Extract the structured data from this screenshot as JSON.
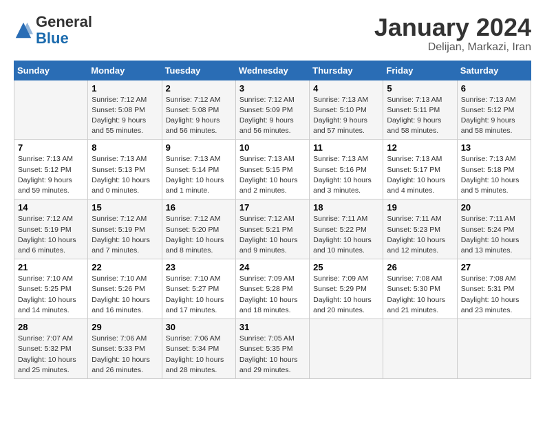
{
  "logo": {
    "general": "General",
    "blue": "Blue"
  },
  "title": {
    "month_year": "January 2024",
    "location": "Delijan, Markazi, Iran"
  },
  "headers": [
    "Sunday",
    "Monday",
    "Tuesday",
    "Wednesday",
    "Thursday",
    "Friday",
    "Saturday"
  ],
  "weeks": [
    [
      null,
      {
        "day": 1,
        "sunrise": "7:12 AM",
        "sunset": "5:08 PM",
        "daylight": "9 hours and 55 minutes."
      },
      {
        "day": 2,
        "sunrise": "7:12 AM",
        "sunset": "5:08 PM",
        "daylight": "9 hours and 56 minutes."
      },
      {
        "day": 3,
        "sunrise": "7:12 AM",
        "sunset": "5:09 PM",
        "daylight": "9 hours and 56 minutes."
      },
      {
        "day": 4,
        "sunrise": "7:13 AM",
        "sunset": "5:10 PM",
        "daylight": "9 hours and 57 minutes."
      },
      {
        "day": 5,
        "sunrise": "7:13 AM",
        "sunset": "5:11 PM",
        "daylight": "9 hours and 58 minutes."
      },
      {
        "day": 6,
        "sunrise": "7:13 AM",
        "sunset": "5:12 PM",
        "daylight": "9 hours and 58 minutes."
      }
    ],
    [
      {
        "day": 7,
        "sunrise": "7:13 AM",
        "sunset": "5:12 PM",
        "daylight": "9 hours and 59 minutes."
      },
      {
        "day": 8,
        "sunrise": "7:13 AM",
        "sunset": "5:13 PM",
        "daylight": "10 hours and 0 minutes."
      },
      {
        "day": 9,
        "sunrise": "7:13 AM",
        "sunset": "5:14 PM",
        "daylight": "10 hours and 1 minute."
      },
      {
        "day": 10,
        "sunrise": "7:13 AM",
        "sunset": "5:15 PM",
        "daylight": "10 hours and 2 minutes."
      },
      {
        "day": 11,
        "sunrise": "7:13 AM",
        "sunset": "5:16 PM",
        "daylight": "10 hours and 3 minutes."
      },
      {
        "day": 12,
        "sunrise": "7:13 AM",
        "sunset": "5:17 PM",
        "daylight": "10 hours and 4 minutes."
      },
      {
        "day": 13,
        "sunrise": "7:13 AM",
        "sunset": "5:18 PM",
        "daylight": "10 hours and 5 minutes."
      }
    ],
    [
      {
        "day": 14,
        "sunrise": "7:12 AM",
        "sunset": "5:19 PM",
        "daylight": "10 hours and 6 minutes."
      },
      {
        "day": 15,
        "sunrise": "7:12 AM",
        "sunset": "5:19 PM",
        "daylight": "10 hours and 7 minutes."
      },
      {
        "day": 16,
        "sunrise": "7:12 AM",
        "sunset": "5:20 PM",
        "daylight": "10 hours and 8 minutes."
      },
      {
        "day": 17,
        "sunrise": "7:12 AM",
        "sunset": "5:21 PM",
        "daylight": "10 hours and 9 minutes."
      },
      {
        "day": 18,
        "sunrise": "7:11 AM",
        "sunset": "5:22 PM",
        "daylight": "10 hours and 10 minutes."
      },
      {
        "day": 19,
        "sunrise": "7:11 AM",
        "sunset": "5:23 PM",
        "daylight": "10 hours and 12 minutes."
      },
      {
        "day": 20,
        "sunrise": "7:11 AM",
        "sunset": "5:24 PM",
        "daylight": "10 hours and 13 minutes."
      }
    ],
    [
      {
        "day": 21,
        "sunrise": "7:10 AM",
        "sunset": "5:25 PM",
        "daylight": "10 hours and 14 minutes."
      },
      {
        "day": 22,
        "sunrise": "7:10 AM",
        "sunset": "5:26 PM",
        "daylight": "10 hours and 16 minutes."
      },
      {
        "day": 23,
        "sunrise": "7:10 AM",
        "sunset": "5:27 PM",
        "daylight": "10 hours and 17 minutes."
      },
      {
        "day": 24,
        "sunrise": "7:09 AM",
        "sunset": "5:28 PM",
        "daylight": "10 hours and 18 minutes."
      },
      {
        "day": 25,
        "sunrise": "7:09 AM",
        "sunset": "5:29 PM",
        "daylight": "10 hours and 20 minutes."
      },
      {
        "day": 26,
        "sunrise": "7:08 AM",
        "sunset": "5:30 PM",
        "daylight": "10 hours and 21 minutes."
      },
      {
        "day": 27,
        "sunrise": "7:08 AM",
        "sunset": "5:31 PM",
        "daylight": "10 hours and 23 minutes."
      }
    ],
    [
      {
        "day": 28,
        "sunrise": "7:07 AM",
        "sunset": "5:32 PM",
        "daylight": "10 hours and 25 minutes."
      },
      {
        "day": 29,
        "sunrise": "7:06 AM",
        "sunset": "5:33 PM",
        "daylight": "10 hours and 26 minutes."
      },
      {
        "day": 30,
        "sunrise": "7:06 AM",
        "sunset": "5:34 PM",
        "daylight": "10 hours and 28 minutes."
      },
      {
        "day": 31,
        "sunrise": "7:05 AM",
        "sunset": "5:35 PM",
        "daylight": "10 hours and 29 minutes."
      },
      null,
      null,
      null
    ]
  ]
}
